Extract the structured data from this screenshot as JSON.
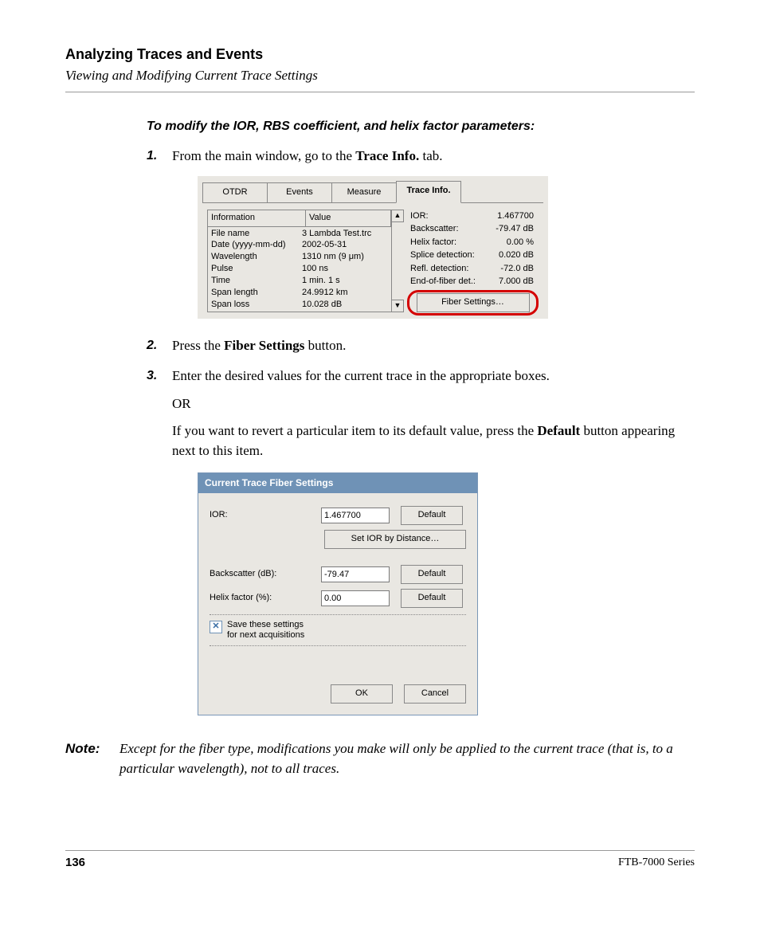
{
  "header": {
    "chapter": "Analyzing Traces and Events",
    "section": "Viewing and Modifying Current Trace Settings"
  },
  "intro": "To modify the IOR, RBS coefficient, and helix factor parameters:",
  "steps": {
    "s1_a": "From the main window, go to the ",
    "s1_b": "Trace Info.",
    "s1_c": " tab.",
    "s2_a": "Press the ",
    "s2_b": "Fiber Settings",
    "s2_c": " button.",
    "s3": "Enter the desired values for the current trace in the appropriate boxes.",
    "or": "OR",
    "s3cont_a": "If you want to revert a particular item to its default value, press the ",
    "s3cont_b": "Default",
    "s3cont_c": " button appearing next to this item."
  },
  "shot1": {
    "tabs": {
      "otdr": "OTDR",
      "events": "Events",
      "measure": "Measure",
      "traceinfo": "Trace Info."
    },
    "head": {
      "info": "Information",
      "value": "Value"
    },
    "rows": [
      {
        "k": "File name",
        "v": "3 Lambda Test.trc"
      },
      {
        "k": "Date (yyyy-mm-dd)",
        "v": "2002-05-31"
      },
      {
        "k": "Wavelength",
        "v": "1310 nm (9 μm)"
      },
      {
        "k": "Pulse",
        "v": "100 ns"
      },
      {
        "k": "Time",
        "v": "1 min. 1 s"
      },
      {
        "k": "Span length",
        "v": "24.9912 km"
      },
      {
        "k": "Span loss",
        "v": "10.028 dB"
      }
    ],
    "right": [
      {
        "k": "IOR:",
        "v": "1.467700"
      },
      {
        "k": "Backscatter:",
        "v": "-79.47 dB"
      },
      {
        "k": "Helix factor:",
        "v": "0.00 %"
      },
      {
        "k": "Splice detection:",
        "v": "0.020 dB"
      },
      {
        "k": "Refl. detection:",
        "v": "-72.0 dB"
      },
      {
        "k": "End-of-fiber det.:",
        "v": "7.000 dB"
      }
    ],
    "fiber_btn": "Fiber Settings…",
    "scroll_up": "▲",
    "scroll_down": "▼"
  },
  "shot2": {
    "title": "Current Trace Fiber Settings",
    "ior_label": "IOR:",
    "ior_value": "1.467700",
    "set_ior_btn": "Set IOR by Distance…",
    "backscatter_label": "Backscatter (dB):",
    "backscatter_value": "-79.47",
    "helix_label": "Helix factor (%):",
    "helix_value": "0.00",
    "default_btn": "Default",
    "save_check_line1": "Save these settings",
    "save_check_line2": "for next acquisitions",
    "check_mark": "✕",
    "ok": "OK",
    "cancel": "Cancel"
  },
  "note": {
    "label": "Note:",
    "text": "Except for the fiber type, modifications you make will only be applied to the current trace (that is, to a particular wavelength), not to all traces."
  },
  "footer": {
    "page": "136",
    "product": "FTB-7000 Series"
  }
}
